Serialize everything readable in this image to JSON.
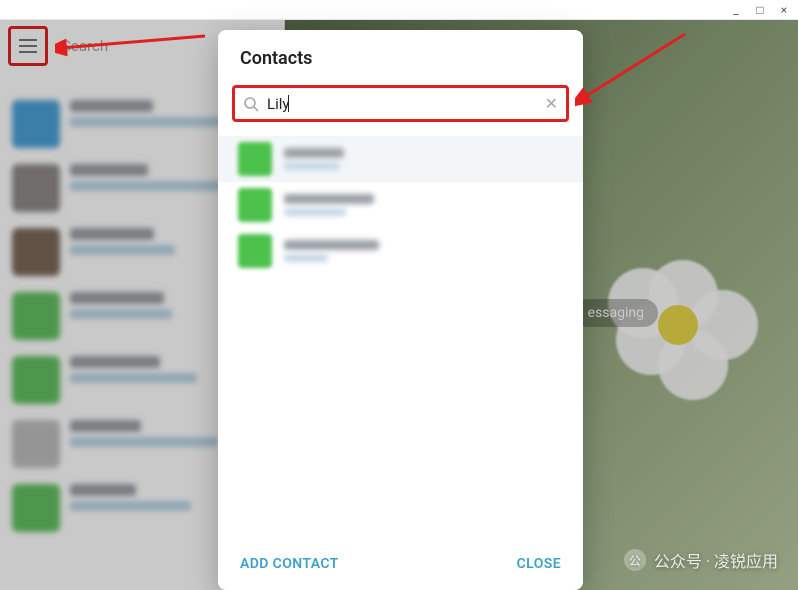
{
  "window": {
    "minimize": "_",
    "maximize": "□",
    "close": "×"
  },
  "sidebar": {
    "search_placeholder": "Search",
    "chats": [
      {
        "avatar_color": "#4aa0d5"
      },
      {
        "avatar_color": "#8d8a87"
      },
      {
        "avatar_color": "#7a6655"
      },
      {
        "avatar_color": "#5fbf5f"
      },
      {
        "avatar_color": "#5fbf5f"
      },
      {
        "avatar_color": "#bdbdbd"
      },
      {
        "avatar_color": "#5fbf5f"
      }
    ]
  },
  "main": {
    "pill_label": "essaging"
  },
  "modal": {
    "title": "Contacts",
    "search_value": "Lily",
    "results": [
      {
        "avatar_color": "#4cc24c"
      },
      {
        "avatar_color": "#4cc24c"
      },
      {
        "avatar_color": "#4cc24c"
      }
    ],
    "add_label": "ADD CONTACT",
    "close_label": "CLOSE"
  },
  "watermark": {
    "text": "公众号 · 凌锐应用",
    "icon": "公"
  },
  "colors": {
    "accent": "#3fa0c9",
    "highlight_border": "#e02020"
  }
}
